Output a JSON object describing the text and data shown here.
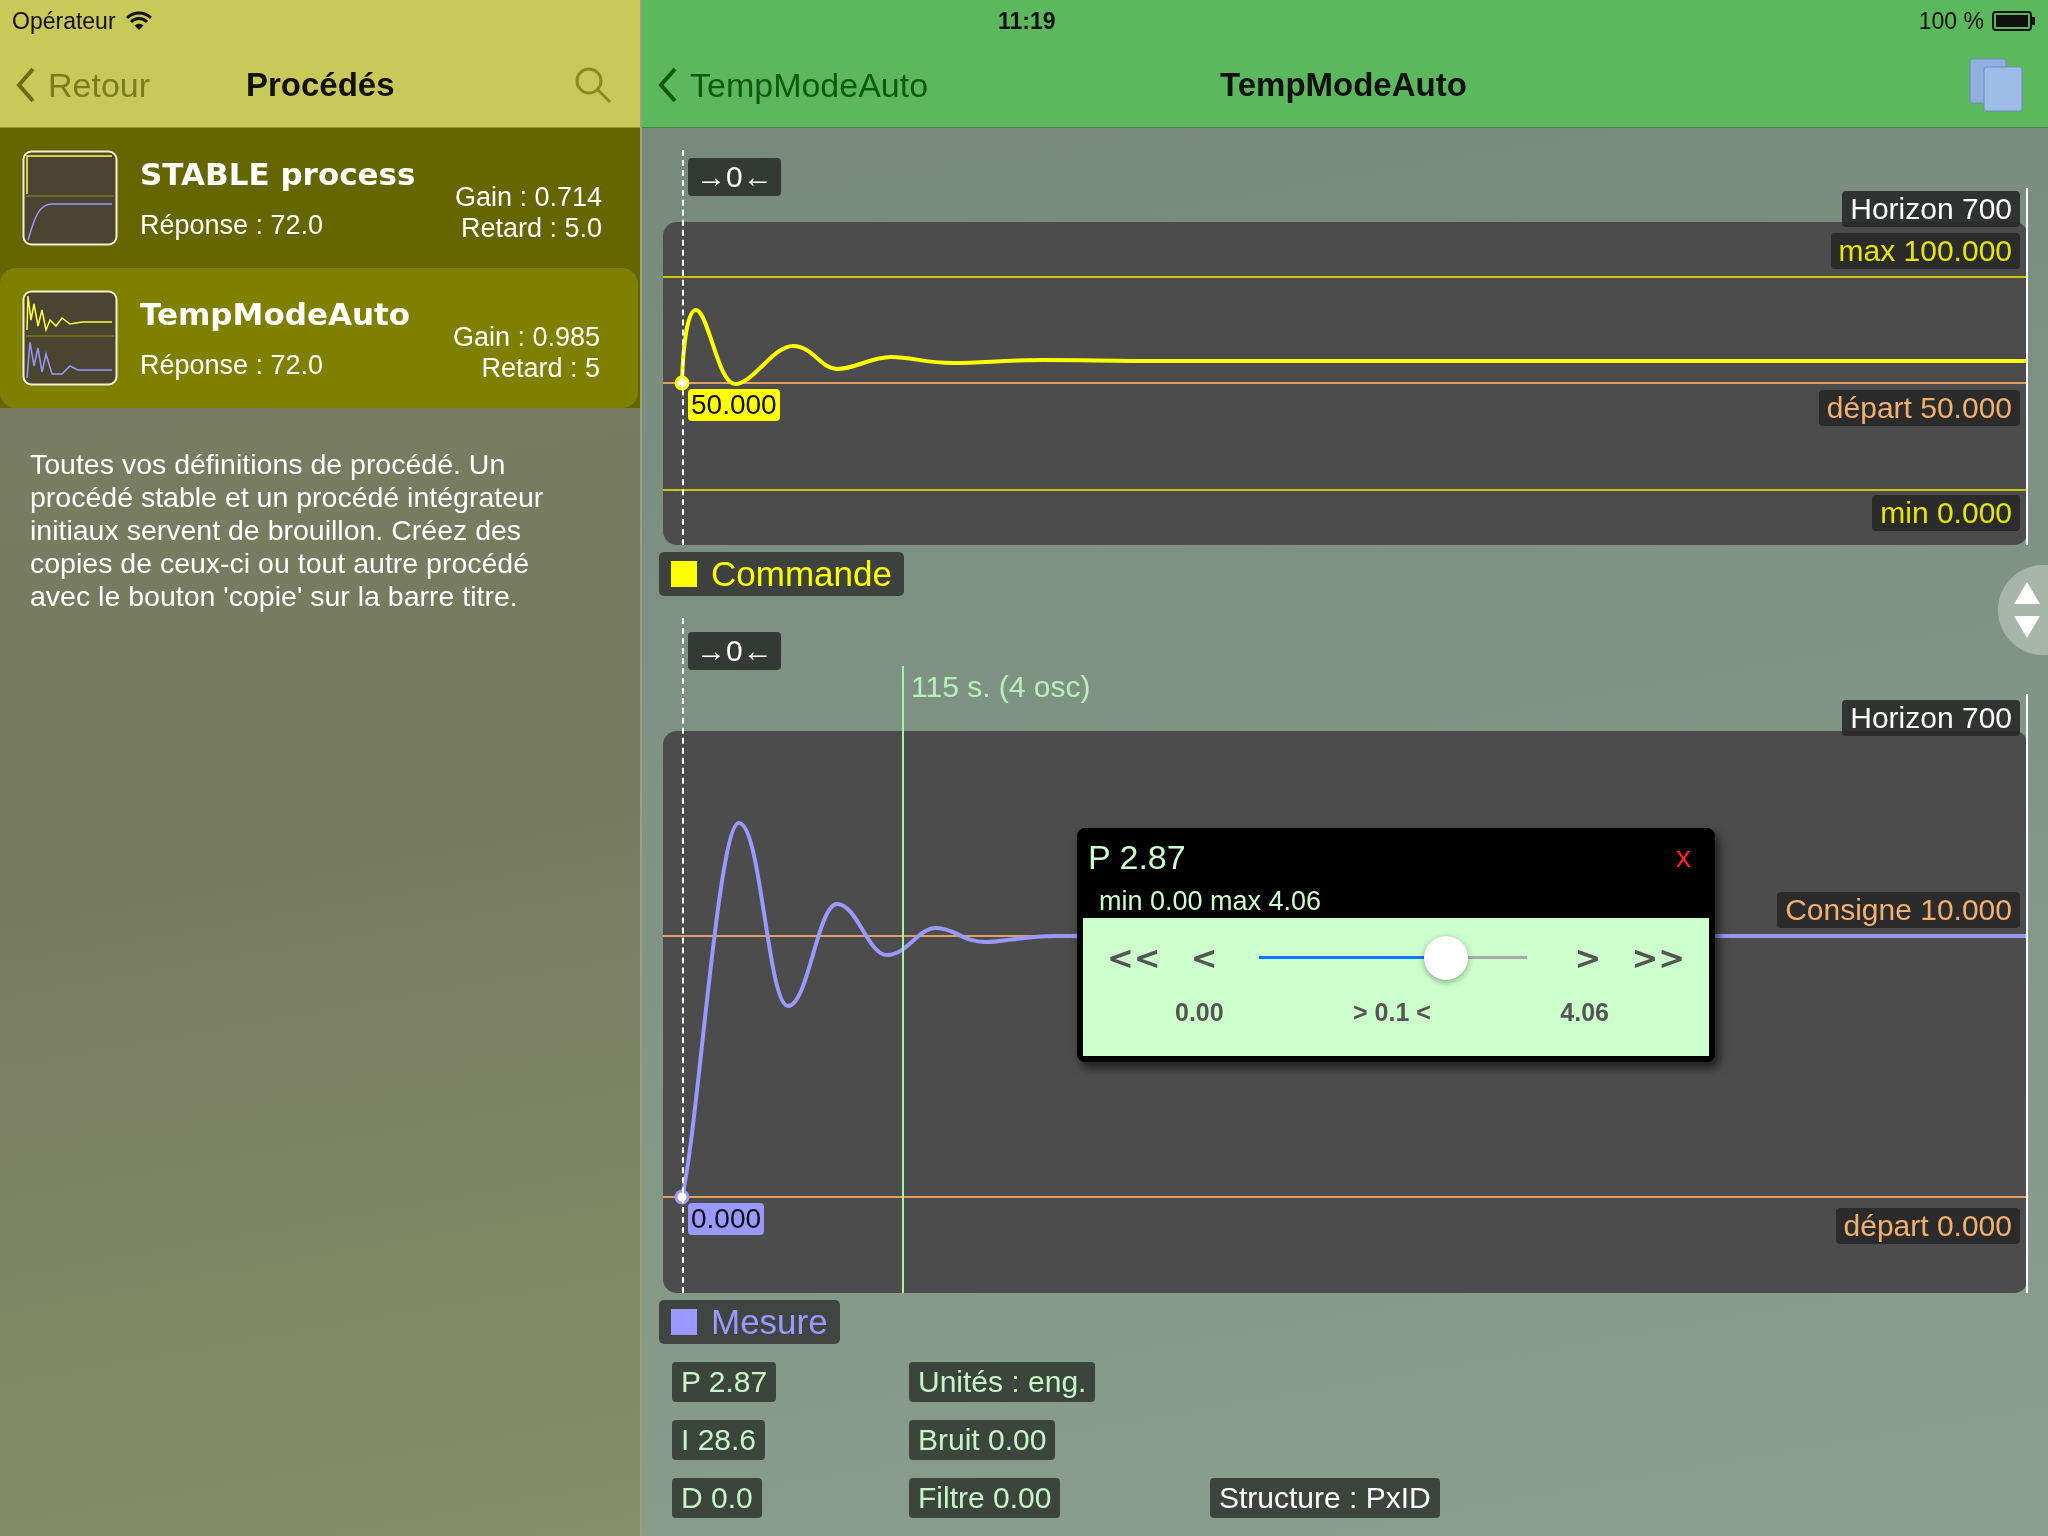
{
  "status_bar": {
    "carrier": "Opérateur",
    "time": "11:19",
    "battery": "100 %"
  },
  "left_nav": {
    "back": "Retour",
    "title": "Procédés"
  },
  "processes": [
    {
      "name": "STABLE process",
      "kind": "stable",
      "response": "Réponse : 72.0",
      "gain": "Gain : 0.714",
      "delay": "Retard : 5.0",
      "selected": false
    },
    {
      "name": "TempModeAuto",
      "kind": "oscillating",
      "response": "Réponse : 72.0",
      "gain": "Gain : 0.985",
      "delay": "Retard : 5",
      "selected": true
    }
  ],
  "description": "Toutes vos définitions de procédé. Un procédé stable et un procédé intégrateur initiaux servent de brouillon. Créez des copies de ceux-ci ou tout autre procédé avec le bouton 'copie' sur la barre titre.",
  "right_nav": {
    "back": "TempModeAuto",
    "title": "TempModeAuto"
  },
  "charts": [
    {
      "kind": "command",
      "zero_button": "→0←",
      "horizon": "Horizon 700",
      "start_value": "50.000",
      "color": "#ffff00",
      "legend": "Commande",
      "labels": [
        {
          "kind": "max",
          "text": "max 100.000"
        },
        {
          "kind": "start",
          "text": "départ 50.000"
        },
        {
          "kind": "min",
          "text": "min 0.000"
        }
      ]
    },
    {
      "kind": "measure",
      "zero_button": "→0←",
      "horizon": "Horizon 700",
      "start_value": "0.000",
      "color": "#9999ff",
      "legend": "Mesure",
      "period_marker": "115 s. (4 osc)",
      "labels": [
        {
          "kind": "setpoint",
          "text": "Consigne 10.000"
        },
        {
          "kind": "start",
          "text": "départ 0.000"
        }
      ]
    }
  ],
  "popup": {
    "title": "P 2.87",
    "close": "x",
    "range": "min 0.00  max 4.06",
    "buttons": [
      "<<",
      "<",
      ">",
      ">>"
    ],
    "level": 0.7,
    "min_label": "0.00",
    "step_label": "> 0.1 <",
    "max_label": "4.06"
  },
  "parameters": [
    [
      {
        "kind": "tuning",
        "text": "P 2.87"
      },
      {
        "kind": "option",
        "text": "Unités : eng."
      }
    ],
    [
      {
        "kind": "tuning",
        "text": "I 28.6"
      },
      {
        "kind": "option",
        "text": "Bruit 0.00"
      }
    ],
    [
      {
        "kind": "tuning",
        "text": "D 0.0"
      },
      {
        "kind": "option",
        "text": "Filtre 0.00"
      },
      {
        "kind": "structure",
        "text": "Structure : PxID"
      }
    ]
  ]
}
